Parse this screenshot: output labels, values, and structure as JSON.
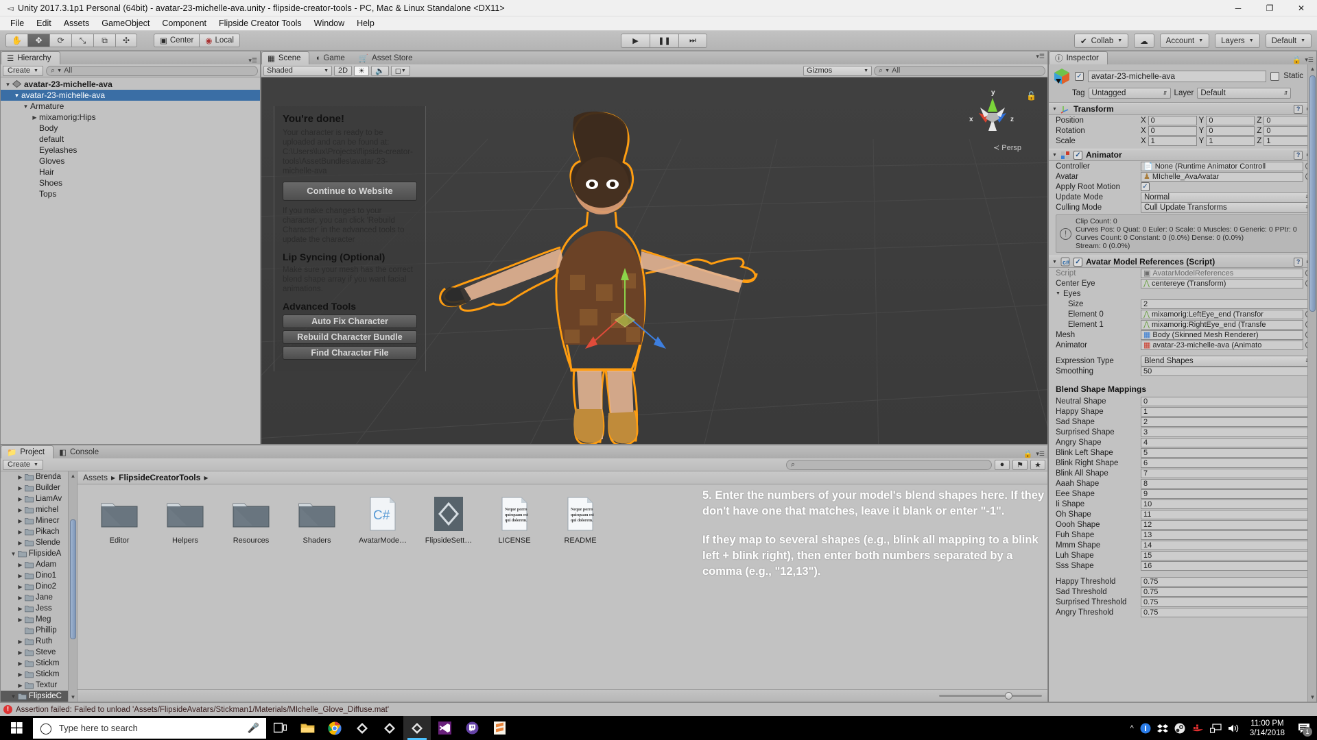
{
  "window": {
    "title": "Unity 2017.3.1p1 Personal (64bit) - avatar-23-michelle-ava.unity - flipside-creator-tools - PC, Mac & Linux Standalone <DX11>",
    "app_icon": "unity-icon",
    "minimize": "─",
    "maximize": "❐",
    "close": "✕"
  },
  "menubar": {
    "items": [
      "File",
      "Edit",
      "Assets",
      "GameObject",
      "Component",
      "Flipside Creator Tools",
      "Window",
      "Help"
    ]
  },
  "toolbar": {
    "tools": [
      {
        "name": "hand-tool",
        "glyph": "✋"
      },
      {
        "name": "move-tool",
        "glyph": "✥"
      },
      {
        "name": "rotate-tool",
        "glyph": "⟳"
      },
      {
        "name": "scale-tool",
        "glyph": "⤡"
      },
      {
        "name": "rect-tool",
        "glyph": "⧉"
      },
      {
        "name": "transform-tool",
        "glyph": "✣"
      }
    ],
    "pivot": "Center",
    "space": "Local",
    "play": "▶",
    "pause": "❚❚",
    "step": "⏭",
    "collab": "Collab",
    "cloud": "☁",
    "account": "Account",
    "layers": "Layers",
    "layout": "Default"
  },
  "hierarchy": {
    "tab": "Hierarchy",
    "create": "Create",
    "search_placeholder": "All",
    "items": [
      {
        "label": "avatar-23-michelle-ava",
        "depth": 0,
        "arrow": "open",
        "scene": true,
        "selected": false
      },
      {
        "label": "avatar-23-michelle-ava",
        "depth": 1,
        "arrow": "open",
        "scene": false,
        "selected": true
      },
      {
        "label": "Armature",
        "depth": 2,
        "arrow": "open",
        "scene": false,
        "selected": false
      },
      {
        "label": "mixamorig:Hips",
        "depth": 3,
        "arrow": "closed",
        "scene": false,
        "selected": false
      },
      {
        "label": "Body",
        "depth": 3,
        "arrow": "none",
        "scene": false,
        "selected": false
      },
      {
        "label": "default",
        "depth": 3,
        "arrow": "none",
        "scene": false,
        "selected": false
      },
      {
        "label": "Eyelashes",
        "depth": 3,
        "arrow": "none",
        "scene": false,
        "selected": false
      },
      {
        "label": "Gloves",
        "depth": 3,
        "arrow": "none",
        "scene": false,
        "selected": false
      },
      {
        "label": "Hair",
        "depth": 3,
        "arrow": "none",
        "scene": false,
        "selected": false
      },
      {
        "label": "Shoes",
        "depth": 3,
        "arrow": "none",
        "scene": false,
        "selected": false
      },
      {
        "label": "Tops",
        "depth": 3,
        "arrow": "none",
        "scene": false,
        "selected": false
      }
    ]
  },
  "scene": {
    "tabs": [
      {
        "label": "Scene",
        "icon": "grid-icon",
        "active": true
      },
      {
        "label": "Game",
        "icon": "gamepad-icon",
        "active": false
      },
      {
        "label": "Asset Store",
        "icon": "store-icon",
        "active": false
      }
    ],
    "draw_mode": "Shaded",
    "toggle_2d": "2D",
    "light_icon": "sun-icon",
    "audio_icon": "speaker-icon",
    "fx_icon": "image-icon",
    "gizmos": "Gizmos",
    "search_placeholder": "All",
    "persp_label": "Persp",
    "axis_labels": {
      "x": "x",
      "y": "y",
      "z": "z"
    },
    "flipside_panel": {
      "heading": "You're done!",
      "body": "Your character is ready to be uploaded and can be found at: C:\\Users\\lux\\Projects\\flipside-creator-tools\\AssetBundles\\avatar-23-michelle-ava",
      "primary_button": "Continue to Website",
      "note": "If you make changes to your character, you can click 'Rebuild Character' in the advanced tools to update the character",
      "lipsync_heading": "Lip Syncing (Optional)",
      "lipsync_body": "Make sure your mesh has the correct blend shape array if you want facial animations.",
      "advanced_heading": "Advanced Tools",
      "advanced_buttons": [
        "Auto Fix Character",
        "Rebuild Character Bundle",
        "Find Character File"
      ]
    }
  },
  "inspector": {
    "tab": "Inspector",
    "object_name": "avatar-23-michelle-ava",
    "enabled": true,
    "static_label": "Static",
    "tag_label": "Tag",
    "tag_value": "Untagged",
    "layer_label": "Layer",
    "layer_value": "Default",
    "transform": {
      "title": "Transform",
      "rows": [
        {
          "name": "Position",
          "x": "0",
          "y": "0",
          "z": "0"
        },
        {
          "name": "Rotation",
          "x": "0",
          "y": "0",
          "z": "0"
        },
        {
          "name": "Scale",
          "x": "1",
          "y": "1",
          "z": "1"
        }
      ]
    },
    "animator": {
      "title": "Animator",
      "enabled": true,
      "controller_label": "Controller",
      "controller_value": "None (Runtime Animator Controll",
      "avatar_label": "Avatar",
      "avatar_value": "MIchelle_AvaAvatar",
      "root_motion_label": "Apply Root Motion",
      "root_motion_value": true,
      "update_mode_label": "Update Mode",
      "update_mode_value": "Normal",
      "culling_mode_label": "Culling Mode",
      "culling_mode_value": "Cull Update Transforms",
      "info_lines": [
        "Clip Count: 0",
        "Curves Pos: 0 Quat: 0 Euler: 0 Scale: 0 Muscles: 0 Generic: 0 PPtr: 0",
        "Curves Count: 0 Constant: 0 (0.0%) Dense: 0 (0.0%)",
        "Stream: 0 (0.0%)"
      ]
    },
    "avatar_model_references": {
      "title": "Avatar Model References (Script)",
      "enabled": true,
      "script_label": "Script",
      "script_value": "AvatarModelReferences",
      "center_eye_label": "Center Eye",
      "center_eye_value": "centereye (Transform)",
      "eyes_label": "Eyes",
      "size_label": "Size",
      "size_value": "2",
      "eye_elements": [
        {
          "label": "Element 0",
          "value": "mixamorig:LeftEye_end (Transfor"
        },
        {
          "label": "Element 1",
          "value": "mixamorig:RightEye_end (Transfe"
        }
      ],
      "mesh_label": "Mesh",
      "mesh_value": "Body (Skinned Mesh Renderer)",
      "animator_label": "Animator",
      "animator_value": "avatar-23-michelle-ava (Animato",
      "expression_type_label": "Expression Type",
      "expression_type_value": "Blend Shapes",
      "smoothing_label": "Smoothing",
      "smoothing_value": "50",
      "blend_shape_title": "Blend Shape Mappings",
      "blend_shapes": [
        {
          "label": "Neutral Shape",
          "value": "0"
        },
        {
          "label": "Happy Shape",
          "value": "1"
        },
        {
          "label": "Sad Shape",
          "value": "2"
        },
        {
          "label": "Surprised Shape",
          "value": "3"
        },
        {
          "label": "Angry Shape",
          "value": "4"
        },
        {
          "label": "Blink Left Shape",
          "value": "5"
        },
        {
          "label": "Blink Right Shape",
          "value": "6"
        },
        {
          "label": "Blink All Shape",
          "value": "7"
        },
        {
          "label": "Aaah Shape",
          "value": "8"
        },
        {
          "label": "Eee Shape",
          "value": "9"
        },
        {
          "label": "Ii Shape",
          "value": "10"
        },
        {
          "label": "Oh Shape",
          "value": "11"
        },
        {
          "label": "Oooh Shape",
          "value": "12"
        },
        {
          "label": "Fuh Shape",
          "value": "13"
        },
        {
          "label": "Mmm Shape",
          "value": "14"
        },
        {
          "label": "Luh Shape",
          "value": "15"
        },
        {
          "label": "Sss Shape",
          "value": "16"
        }
      ],
      "thresholds": [
        {
          "label": "Happy Threshold",
          "value": "0.75"
        },
        {
          "label": "Sad Threshold",
          "value": "0.75"
        },
        {
          "label": "Surprised Threshold",
          "value": "0.75"
        },
        {
          "label": "Angry Threshold",
          "value": "0.75"
        }
      ]
    }
  },
  "project": {
    "tabs": [
      {
        "label": "Project",
        "icon": "folder-icon",
        "active": true
      },
      {
        "label": "Console",
        "icon": "console-icon",
        "active": false
      }
    ],
    "create": "Create",
    "search_placeholder": "",
    "breadcrumb": [
      "Assets",
      "FlipsideCreatorTools"
    ],
    "tree": [
      {
        "label": "Brenda",
        "depth": 2,
        "arrow": "closed",
        "selected": false
      },
      {
        "label": "Builder",
        "depth": 2,
        "arrow": "closed",
        "selected": false
      },
      {
        "label": "LiamAv",
        "depth": 2,
        "arrow": "closed",
        "selected": false
      },
      {
        "label": "michel",
        "depth": 2,
        "arrow": "closed",
        "selected": false
      },
      {
        "label": "Minecr",
        "depth": 2,
        "arrow": "closed",
        "selected": false
      },
      {
        "label": "Pikach",
        "depth": 2,
        "arrow": "closed",
        "selected": false
      },
      {
        "label": "Slende",
        "depth": 2,
        "arrow": "closed",
        "selected": false
      },
      {
        "label": "FlipsideA",
        "depth": 1,
        "arrow": "open",
        "selected": false
      },
      {
        "label": "Adam",
        "depth": 2,
        "arrow": "closed",
        "selected": false
      },
      {
        "label": "Dino1",
        "depth": 2,
        "arrow": "closed",
        "selected": false
      },
      {
        "label": "Dino2",
        "depth": 2,
        "arrow": "closed",
        "selected": false
      },
      {
        "label": "Jane",
        "depth": 2,
        "arrow": "closed",
        "selected": false
      },
      {
        "label": "Jess",
        "depth": 2,
        "arrow": "closed",
        "selected": false
      },
      {
        "label": "Meg",
        "depth": 2,
        "arrow": "closed",
        "selected": false
      },
      {
        "label": "Phillip",
        "depth": 2,
        "arrow": "none",
        "selected": false
      },
      {
        "label": "Ruth",
        "depth": 2,
        "arrow": "closed",
        "selected": false
      },
      {
        "label": "Steve",
        "depth": 2,
        "arrow": "closed",
        "selected": false
      },
      {
        "label": "Stickm",
        "depth": 2,
        "arrow": "closed",
        "selected": false
      },
      {
        "label": "Stickm",
        "depth": 2,
        "arrow": "closed",
        "selected": false
      },
      {
        "label": "Textur",
        "depth": 2,
        "arrow": "closed",
        "selected": false
      },
      {
        "label": "FlipsideC",
        "depth": 1,
        "arrow": "open",
        "selected": true
      }
    ],
    "assets": [
      {
        "name": "Editor",
        "type": "folder"
      },
      {
        "name": "Helpers",
        "type": "folder"
      },
      {
        "name": "Resources",
        "type": "folder"
      },
      {
        "name": "Shaders",
        "type": "folder"
      },
      {
        "name": "AvatarMode…",
        "type": "csharp"
      },
      {
        "name": "FlipsideSett…",
        "type": "unity"
      },
      {
        "name": "LICENSE",
        "type": "text"
      },
      {
        "name": "README",
        "type": "text"
      }
    ],
    "text_doc_lines": [
      "Neque porro",
      "quisquam est",
      "qui dolorem."
    ]
  },
  "overlay_note": {
    "paragraph1": "5. Enter the numbers of your model's blend shapes here. If they don't have one that matches, leave it blank or enter \"-1\".",
    "paragraph2": "If they map to several shapes (e.g., blink all mapping to a blink left + blink right), then enter both numbers separated by a comma (e.g., \"12,13\")."
  },
  "status_bar": {
    "icon": "error-icon",
    "message": "Assertion failed: Failed to unload 'Assets/FlipsideAvatars/Stickman1/Materials/MIchelle_Glove_Diffuse.mat'"
  },
  "taskbar": {
    "start": "windows-icon",
    "search_placeholder": "Type here to search",
    "cortana_icon": "circle-icon",
    "mic_icon": "microphone-icon",
    "apps": [
      {
        "name": "task-view-icon",
        "active": false
      },
      {
        "name": "file-explorer-icon",
        "active": false
      },
      {
        "name": "chrome-icon",
        "active": false
      },
      {
        "name": "unity-icon-1",
        "active": false
      },
      {
        "name": "unity-icon-2",
        "active": false
      },
      {
        "name": "unity-icon-3",
        "active": true
      },
      {
        "name": "visual-studio-icon",
        "active": false
      },
      {
        "name": "twitch-icon",
        "active": false
      },
      {
        "name": "sublime-icon",
        "active": false
      }
    ],
    "tray": [
      {
        "name": "show-hidden-icons",
        "glyph": "∧"
      },
      {
        "name": "onepassword-icon"
      },
      {
        "name": "dropbox-icon"
      },
      {
        "name": "steam-icon"
      },
      {
        "name": "docker-icon"
      },
      {
        "name": "network-icon"
      },
      {
        "name": "volume-icon"
      }
    ],
    "time": "11:00 PM",
    "date": "3/14/2018",
    "notification_count": "1"
  },
  "colors": {
    "unity_panel": "#c2c2c2",
    "selection_blue": "#3a6ea5",
    "scene_bg": "#3b3b3b",
    "outline_orange": "#ff9900",
    "taskbar_bg": "#000000",
    "accent_blue": "#4cc2ff"
  }
}
